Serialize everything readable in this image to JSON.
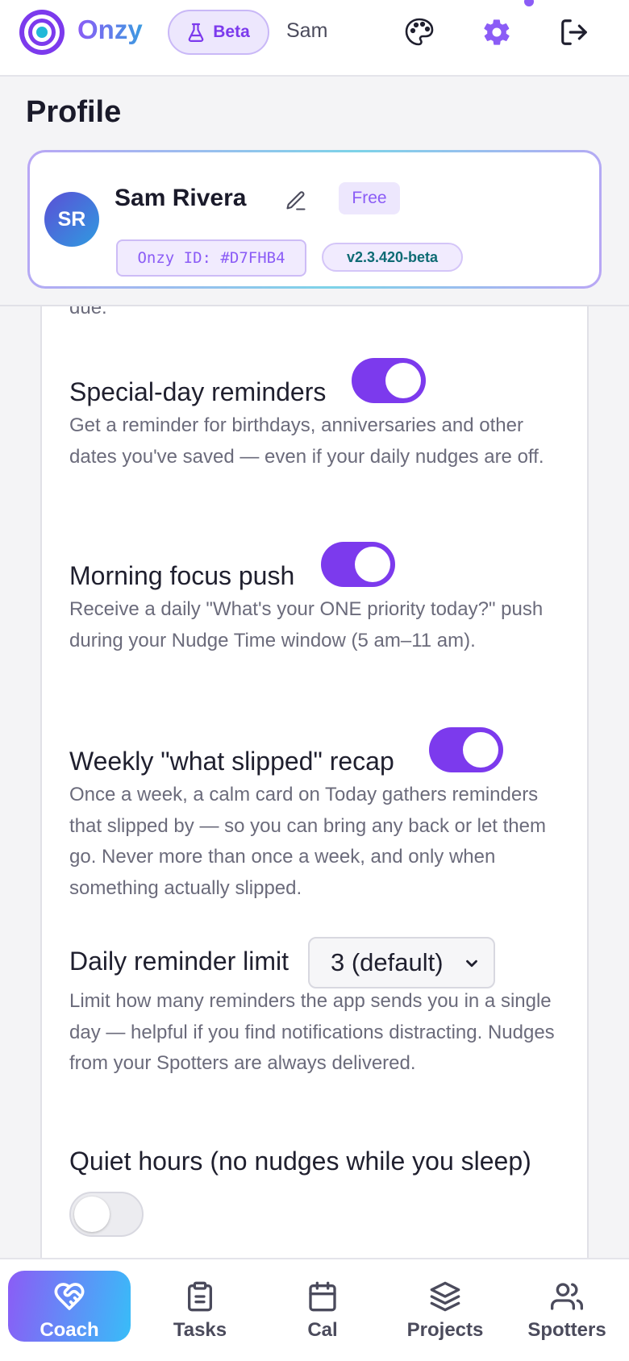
{
  "topbar": {
    "brand": "Onzy",
    "beta_label": "Beta",
    "username": "Sam",
    "icons": [
      "palette-icon",
      "gear-icon",
      "logout-icon"
    ]
  },
  "profile": {
    "page_title": "Profile",
    "initials": "SR",
    "full_name": "Sam Rivera",
    "plan": "Free",
    "onzy_id": "Onzy ID: #D7FHB4",
    "version": "v2.3.420-beta"
  },
  "settings": {
    "cut_text": "due.",
    "special_day": {
      "title": "Special-day reminders",
      "description": "Get a reminder for birthdays, anniversaries and other dates you've saved — even if your daily nudges are off.",
      "enabled": true
    },
    "morning_focus": {
      "title": "Morning focus push",
      "description": "Receive a daily \"What's your ONE priority today?\" push during your Nudge Time window (5 am–11 am).",
      "enabled": true
    },
    "weekly_recap": {
      "title": "Weekly \"what slipped\" recap",
      "description": "Once a week, a calm card on Today gathers reminders that slipped by — so you can bring any back or let them go. Never more than once a week, and only when something actually slipped.",
      "enabled": true
    },
    "daily_limit": {
      "title": "Daily reminder limit",
      "selected": "3 (default)",
      "description": "Limit how many reminders the app sends you in a single day — helpful if you find notifications distracting. Nudges from your Spotters are always delivered."
    },
    "quiet_hours": {
      "title": "Quiet hours (no nudges while you sleep)",
      "enabled": false
    }
  },
  "bottom_nav": {
    "coach": "Coach",
    "tasks": "Tasks",
    "cal": "Cal",
    "projects": "Projects",
    "spotters": "Spotters",
    "active": "Coach"
  },
  "colors": {
    "accent": "#7c3aed",
    "accent_light": "#ede7fd",
    "teal": "#0e6b74"
  }
}
